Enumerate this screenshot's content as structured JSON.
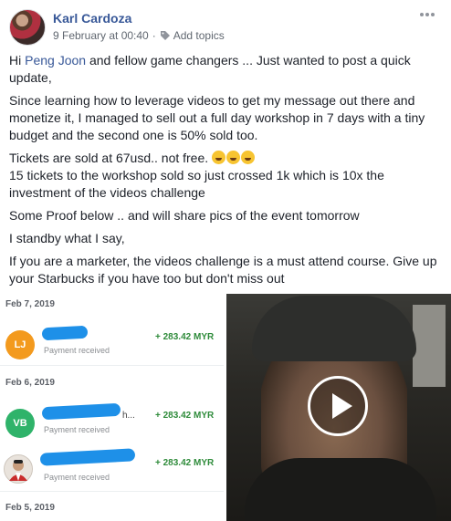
{
  "post": {
    "author": "Karl Cardoza",
    "timestamp": "9 February at 00:40",
    "topics_link": "Add topics",
    "icons": {
      "avatar": "profile-photo",
      "tag": "tag-icon",
      "menu": "more-options-icon",
      "video": "play-icon"
    },
    "colors": {
      "link": "#385898",
      "meta": "#606770",
      "amount": "#2e8b3a",
      "redaction": "#1e90e8"
    }
  },
  "body": {
    "p1_before": "Hi ",
    "mention": "Peng Joon",
    "p1_after": " and fellow game changers ... Just wanted to post a quick update,",
    "p2": "Since learning how to leverage videos to get my message out there and monetize it, I managed to sell out a full day workshop in 7 days with a tiny budget and the second one is 50% sold too.",
    "p3_line1": "Tickets are sold at 67usd.. not free.",
    "p3_line2": "15 tickets to the workshop sold so just crossed 1k which is 10x the investment of the videos challenge",
    "p4": "Some Proof below .. and will share pics of the event tomorrow",
    "p5": "I standby what I say,",
    "p6": "If you are a marketer, the videos challenge is a must attend course. Give up your Starbucks if you have too but don't miss out"
  },
  "payments": {
    "date1": "Feb 7, 2019",
    "row1_initials": "LJ",
    "row1_status": "Payment received",
    "row1_amount": "+ 283.42 MYR",
    "date2": "Feb 6, 2019",
    "row2_initials": "VB",
    "row2_name_tail": "h...",
    "row2_status": "Payment received",
    "row2_amount": "+ 283.42 MYR",
    "row3_status": "Payment received",
    "row3_amount": "+ 283.42 MYR",
    "date3": "Feb 5, 2019"
  }
}
